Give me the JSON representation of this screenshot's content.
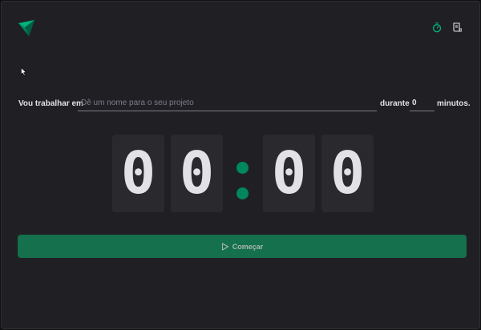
{
  "header": {
    "logo_icon": "timer-logo-icon",
    "nav": [
      {
        "icon": "timer-icon",
        "active": true
      },
      {
        "icon": "scroll-icon",
        "active": false
      }
    ]
  },
  "form": {
    "task_label": "Vou trabalhar em",
    "task_placeholder": "Dê um nome para o seu projeto",
    "task_value": "",
    "during_label": "durante",
    "minutes_value": "0",
    "minutes_label": "minutos."
  },
  "countdown": {
    "minutes": [
      "0",
      "0"
    ],
    "separator": ":",
    "seconds": [
      "0",
      "0"
    ]
  },
  "start_button": {
    "label": "Começar",
    "icon": "play-icon"
  },
  "colors": {
    "background": "#202024",
    "accent": "#00875f",
    "button": "#15704d",
    "digit_bg": "#29292e",
    "text": "#e1e1e6",
    "placeholder": "#7c7c8a"
  }
}
